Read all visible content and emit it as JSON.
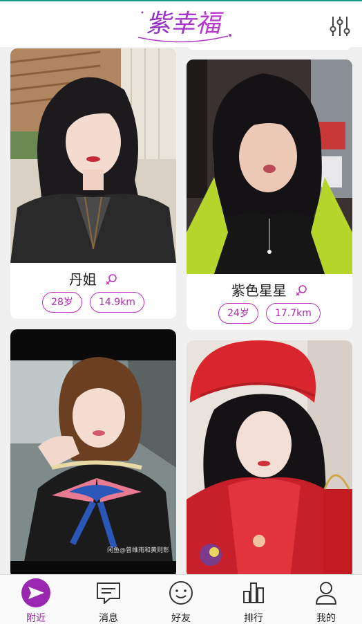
{
  "app": {
    "logo_text": "紫幸福"
  },
  "colors": {
    "accent": "#9a27b0",
    "tag_border": "#c02dbf",
    "header_line": "#1a9d8a"
  },
  "header": {
    "filter_icon": "sliders-icon"
  },
  "cards": [
    {
      "name": "丹姐",
      "age": "28岁",
      "distance": "14.9km",
      "gender_icon": "female-icon"
    },
    {
      "name": "紫色星星",
      "age": "24岁",
      "distance": "17.7km",
      "gender_icon": "female-icon"
    },
    {
      "watermark": "闲鱼@曾维雨和黄则彰"
    }
  ],
  "nav": {
    "items": [
      {
        "label": "附近",
        "icon": "send-icon",
        "active": true
      },
      {
        "label": "消息",
        "icon": "message-icon"
      },
      {
        "label": "好友",
        "icon": "smile-icon"
      },
      {
        "label": "排行",
        "icon": "bar-chart-icon"
      },
      {
        "label": "我的",
        "icon": "person-icon"
      }
    ]
  }
}
